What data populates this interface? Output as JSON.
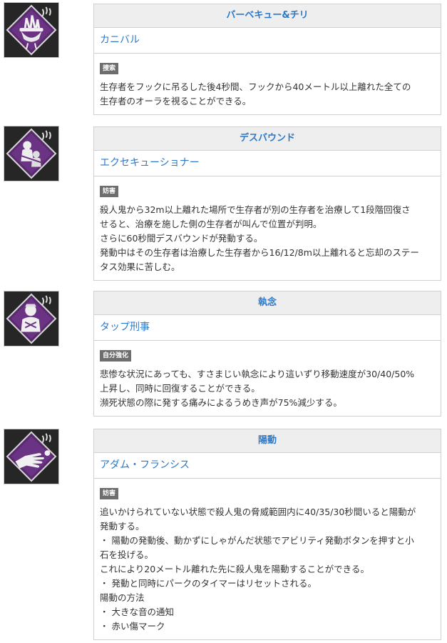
{
  "perks": [
    {
      "title": "バーベキュー&チリ",
      "character": "カニバル",
      "tag": "捜索",
      "lines": [
        "生存者をフックに吊るした後4秒間、フックから40メートル以上離れた全ての",
        "生存者のオーラを視ることができる。"
      ],
      "icon": "bbq-grill-icon"
    },
    {
      "title": "デスバウンド",
      "character": "エクセキューショナー",
      "tag": "妨害",
      "lines": [
        "殺人鬼から32m以上離れた場所で生存者が別の生存者を治療して1段階回復さ",
        "せると、治療を施した側の生存者が叫んで位置が判明。",
        "さらに60秒間デスバウンドが発動する。",
        "発動中はその生存者は治療した生存者から16/12/8m以上離れると忘却のステー",
        "タス効果に苦しむ。"
      ],
      "icon": "bound-survivors-icon"
    },
    {
      "title": "執念",
      "character": "タップ刑事",
      "tag": "自分強化",
      "lines": [
        "悲惨な状況にあっても、すさまじい執念により這いずり移動速度が30/40/50%",
        "上昇し、同時に回復することができる。",
        "瀕死状態の際に発する痛みによるうめき声が75%減少する。"
      ],
      "icon": "detective-icon"
    },
    {
      "title": "陽動",
      "character": "アダム・フランシス",
      "tag": "妨害",
      "lines": [
        "追いかけられていない状態で殺人鬼の脅威範囲内に40/35/30秒間いると陽動が",
        "発動する。",
        "・ 陽動の発動後、動かずにしゃがんだ状態でアビリティ発動ボタンを押すと小",
        "石を投げる。",
        "これにより20メートル離れた先に殺人鬼を陽動することができる。",
        "・ 発動と同時にパークのタイマーはリセットされる。",
        "陽動の方法",
        "・ 大きな音の通知",
        "・ 赤い傷マーク"
      ],
      "icon": "throwing-hand-icon"
    }
  ],
  "colors": {
    "link": "#2e78c8",
    "header_bg": "#eeeeee",
    "border": "#d0d0d0",
    "tag_bg": "#6e6e6e",
    "icon_purple": "#5a2a6e"
  }
}
